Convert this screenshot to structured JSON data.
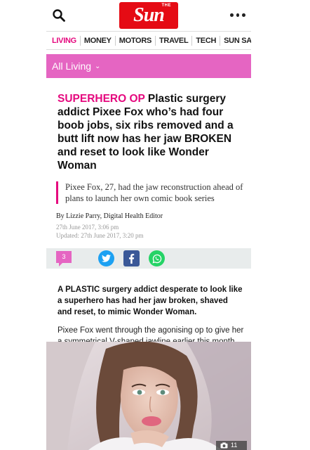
{
  "header": {
    "logo_small": "THE",
    "logo_text": "Sun",
    "search_icon": "search-icon",
    "menu_icon": "more-dots-icon"
  },
  "nav": {
    "items": [
      {
        "label": "LIVING"
      },
      {
        "label": "MONEY"
      },
      {
        "label": "MOTORS"
      },
      {
        "label": "TRAVEL"
      },
      {
        "label": "TECH"
      },
      {
        "label": "SUN SAVERS"
      }
    ]
  },
  "section": {
    "label": "All Living",
    "chevron": "⌄"
  },
  "article": {
    "kicker": "SUPERHERO OP",
    "headline": "Plastic surgery addict Pixee Fox who’s had four boob jobs, six ribs removed and a butt lift now has her jaw BROKEN and reset to look like Wonder Woman",
    "standfirst": "Pixee Fox, 27, had the jaw reconstruction ahead of plans to launch her own comic book series",
    "byline": "By Lizzie Parry, Digital Health Editor",
    "published": "27th June 2017, 3:06 pm",
    "updated": "Updated: 27th June 2017, 3:20 pm",
    "lead": "A PLASTIC surgery addict desperate to look like a superhero has had her jaw broken, shaved and reset, to mimic Wonder Woman.",
    "paragraph": "Pixee Fox went through the agonising op to give her a symmetrical V-shaped jawline earlier this month."
  },
  "share": {
    "comment_count": "3",
    "twitter_icon": "twitter-icon",
    "facebook_icon": "facebook-icon",
    "whatsapp_icon": "whatsapp-icon"
  },
  "photo": {
    "gallery_count": "11",
    "camera_icon": "camera-icon"
  },
  "colors": {
    "brand_red": "#e50b14",
    "accent_pink": "#e5087e",
    "section_pink": "#e565c2",
    "twitter_blue": "#1da1f2",
    "facebook_blue": "#3b5998",
    "whatsapp_green": "#25d366"
  }
}
